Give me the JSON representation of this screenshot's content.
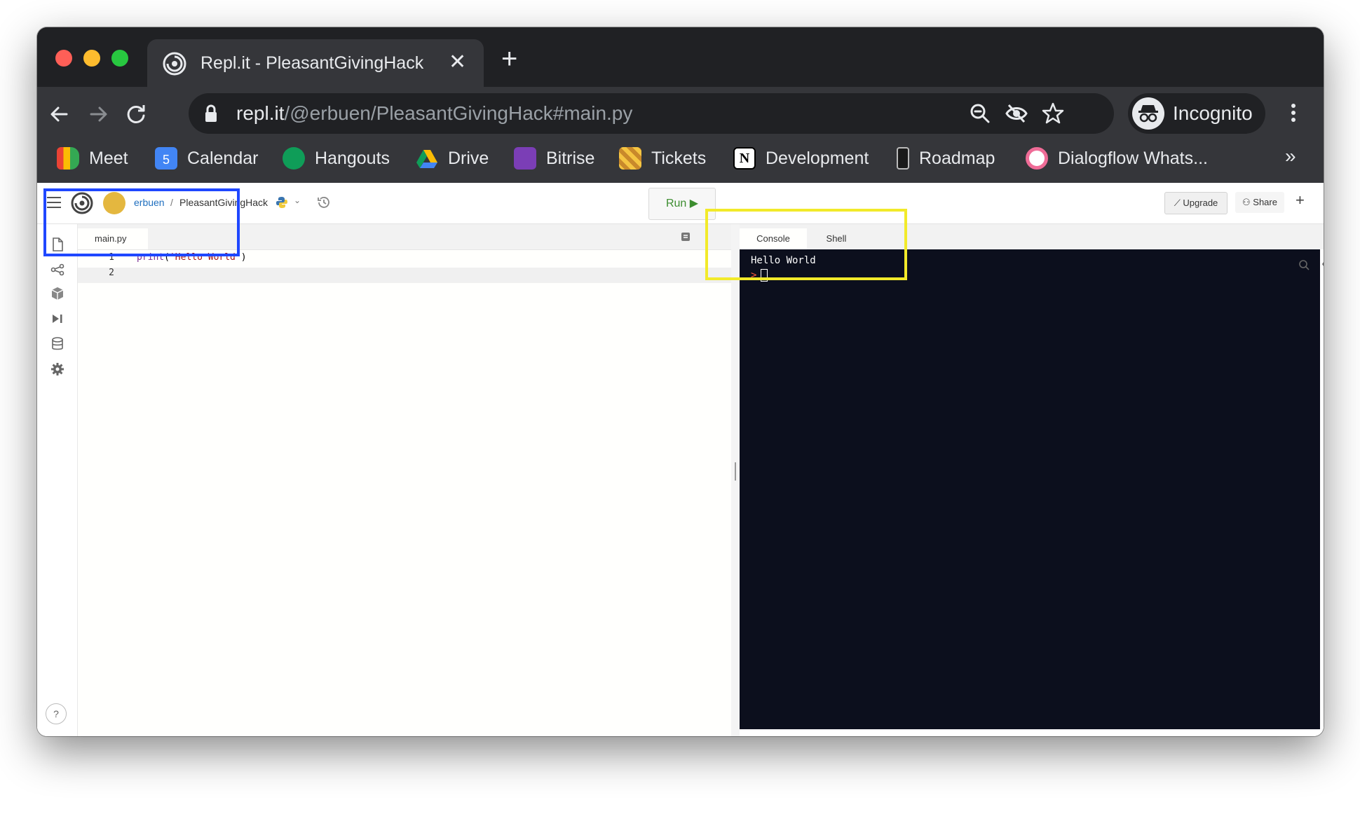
{
  "browser": {
    "tab_title": "Repl.it - PleasantGivingHack",
    "url_host": "repl.it",
    "url_path": "/@erbuen/PleasantGivingHack#main.py",
    "profile_label": "Incognito",
    "bookmarks": [
      {
        "label": "Meet",
        "icon": "meet-icon"
      },
      {
        "label": "Calendar",
        "icon": "calendar-icon"
      },
      {
        "label": "Hangouts",
        "icon": "hangouts-icon"
      },
      {
        "label": "Drive",
        "icon": "drive-icon"
      },
      {
        "label": "Bitrise",
        "icon": "bitrise-icon"
      },
      {
        "label": "Tickets",
        "icon": "barrier-icon"
      },
      {
        "label": "Development",
        "icon": "notion-icon"
      },
      {
        "label": "Roadmap",
        "icon": "phone-icon"
      },
      {
        "label": "Dialogflow Whats...",
        "icon": "dialogflow-icon"
      }
    ],
    "calendar_day": "5",
    "more_label": "»"
  },
  "app": {
    "user": "erbuen",
    "separator": "/",
    "repl_name": "PleasantGivingHack",
    "run_label": "Run ▶",
    "upgrade_label": "Upgrade",
    "share_label": "Share",
    "help_label": "?"
  },
  "editor": {
    "file_tab": "main.py",
    "lines": [
      {
        "number": "1",
        "code_fn": "print",
        "code_str": "'Hello World'"
      },
      {
        "number": "2"
      }
    ],
    "paren_open": "(",
    "paren_close": ")"
  },
  "console": {
    "tabs": [
      "Console",
      "Shell"
    ],
    "output": "Hello World",
    "prompt": ">"
  },
  "colors": {
    "highlight_editor": "#1f47ff",
    "highlight_console": "#f2ea2a",
    "terminal_bg": "#0c0f1d",
    "run_green": "#3c8d2f"
  }
}
